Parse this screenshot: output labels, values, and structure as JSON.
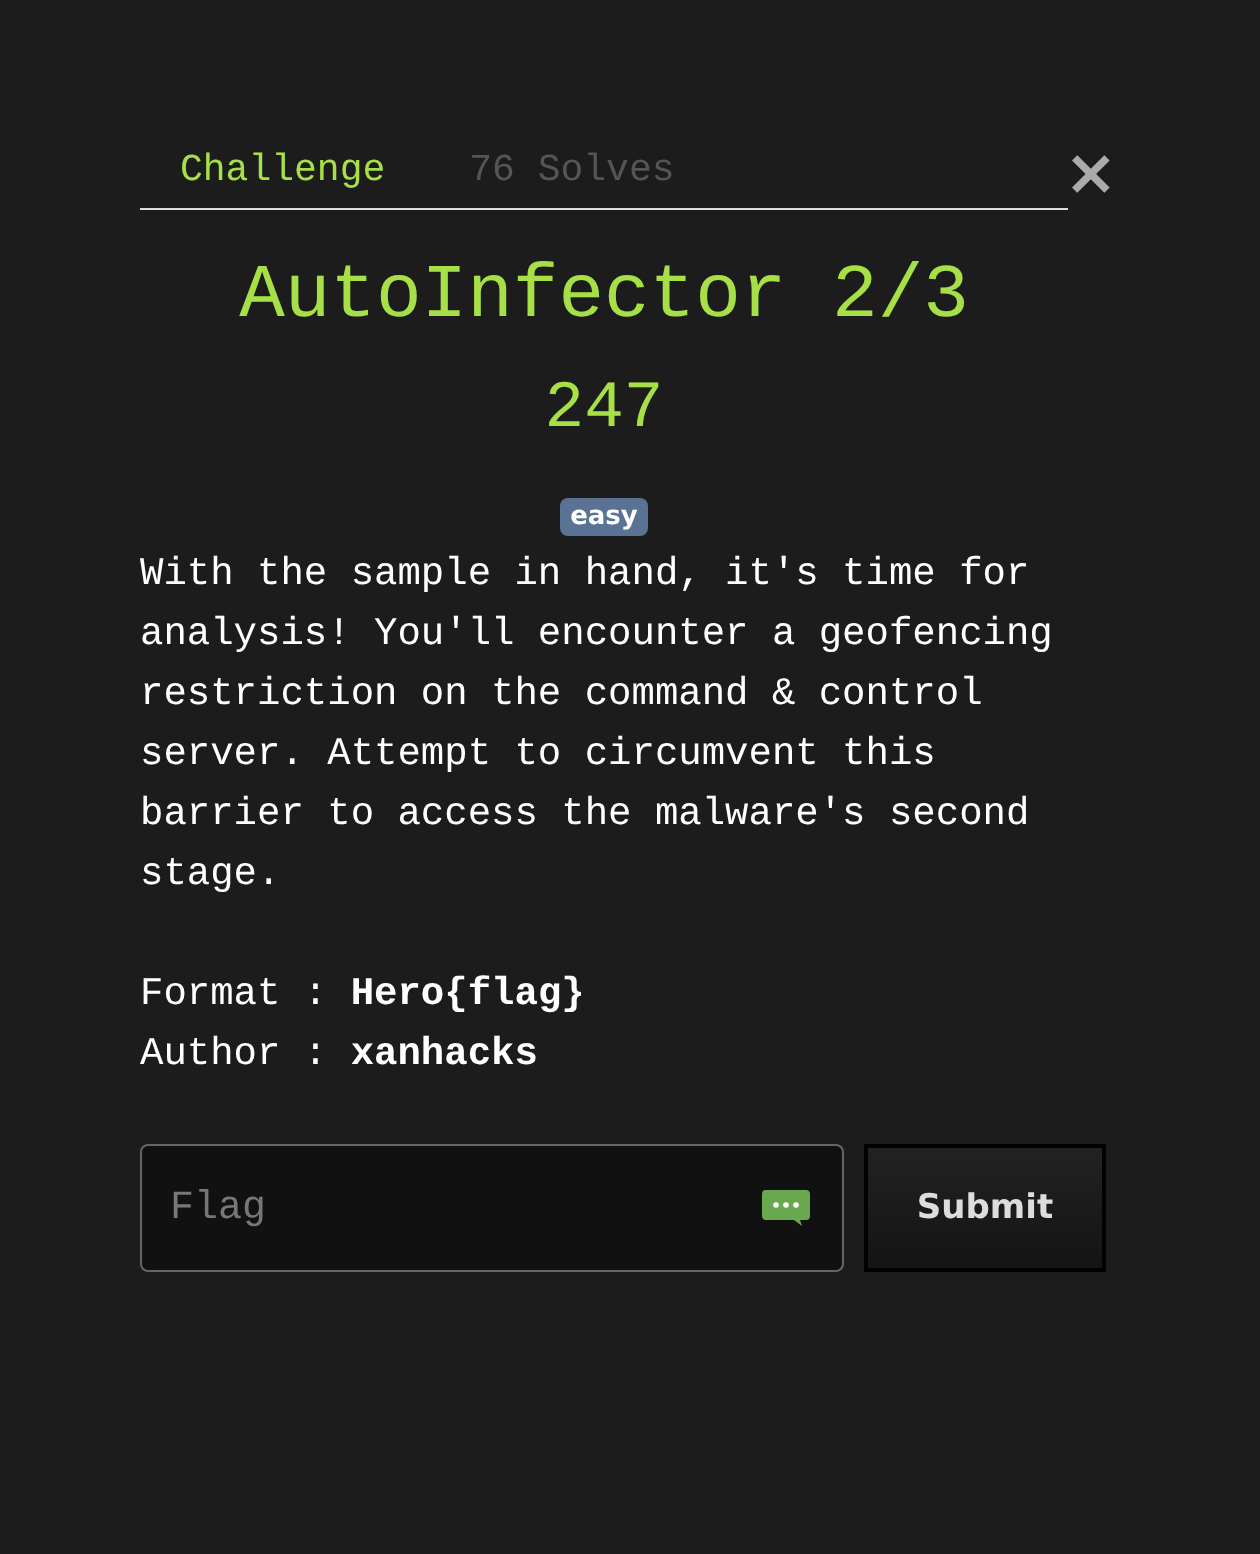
{
  "tabs": [
    {
      "label": "Challenge",
      "selected": true
    },
    {
      "label": "76 Solves",
      "selected": false
    }
  ],
  "close": "×",
  "title": "AutoInfector 2/3",
  "points": "247",
  "tag": "easy",
  "description": "With the sample in hand, it's time for analysis! You'll encounter a geofencing restriction on the command & control server. Attempt to circumvent this barrier to access the malware's second stage.",
  "meta": [
    "Format : **Hero{flag}**",
    "Author : **xanhacks**"
  ],
  "flag_field": {
    "placeholder": "Flag"
  },
  "submit": "Submit"
}
